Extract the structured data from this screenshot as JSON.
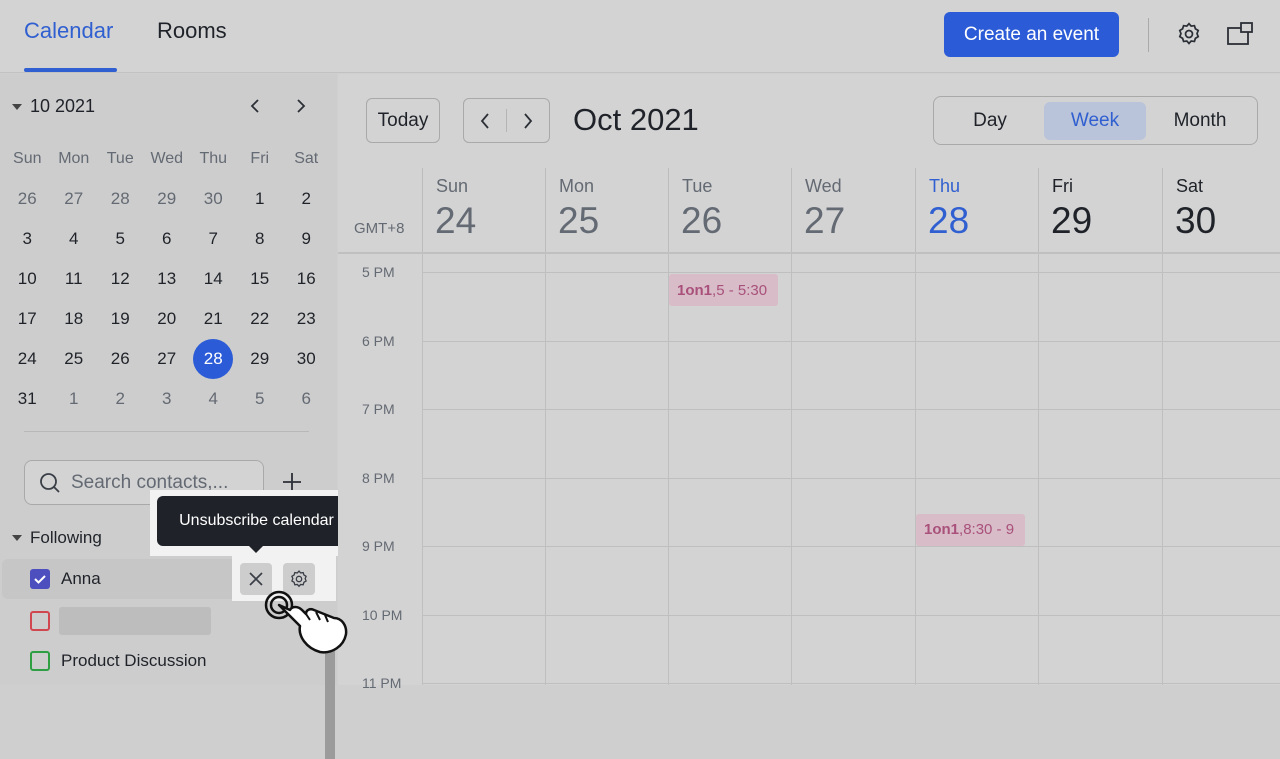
{
  "header": {
    "tabs": [
      {
        "label": "Calendar"
      },
      {
        "label": "Rooms"
      }
    ],
    "create_label": "Create an event"
  },
  "mini": {
    "title": "10 2021",
    "weekdays": [
      "Sun",
      "Mon",
      "Tue",
      "Wed",
      "Thu",
      "Fri",
      "Sat"
    ],
    "weeks": [
      [
        "26",
        "27",
        "28",
        "29",
        "30",
        "1",
        "2"
      ],
      [
        "3",
        "4",
        "5",
        "6",
        "7",
        "8",
        "9"
      ],
      [
        "10",
        "11",
        "12",
        "13",
        "14",
        "15",
        "16"
      ],
      [
        "17",
        "18",
        "19",
        "20",
        "21",
        "22",
        "23"
      ],
      [
        "24",
        "25",
        "26",
        "27",
        "28",
        "29",
        "30"
      ],
      [
        "31",
        "1",
        "2",
        "3",
        "4",
        "5",
        "6"
      ]
    ],
    "today": "28"
  },
  "search": {
    "placeholder": "Search contacts,..."
  },
  "following": {
    "label": "Following",
    "items": [
      {
        "name": "Anna",
        "color": "#4e4fbf",
        "checked": true
      },
      {
        "name": "",
        "color": "#d0474f",
        "checked": false
      },
      {
        "name": "Product Discussion",
        "color": "#2ea043",
        "checked": false
      }
    ]
  },
  "tooltip": "Unsubscribe calendar",
  "toolbar": {
    "today_label": "Today",
    "month_title": "Oct 2021",
    "views": [
      {
        "label": "Day"
      },
      {
        "label": "Week"
      },
      {
        "label": "Month"
      }
    ],
    "active_view": "Week"
  },
  "week": {
    "timezone": "GMT+8",
    "days": [
      {
        "name": "Sun",
        "num": "24"
      },
      {
        "name": "Mon",
        "num": "25"
      },
      {
        "name": "Tue",
        "num": "26"
      },
      {
        "name": "Wed",
        "num": "27"
      },
      {
        "name": "Thu",
        "num": "28"
      },
      {
        "name": "Fri",
        "num": "29"
      },
      {
        "name": "Sat",
        "num": "30"
      }
    ],
    "today_index": 4,
    "times": [
      "5 PM",
      "6 PM",
      "7 PM",
      "8 PM",
      "9 PM",
      "10 PM",
      "11 PM"
    ],
    "events": [
      {
        "title": "1on1",
        "time": "5 - 5:30",
        "day": "Tue"
      },
      {
        "title": "1on1",
        "time": "8:30 - 9",
        "day": "Thu"
      }
    ]
  }
}
